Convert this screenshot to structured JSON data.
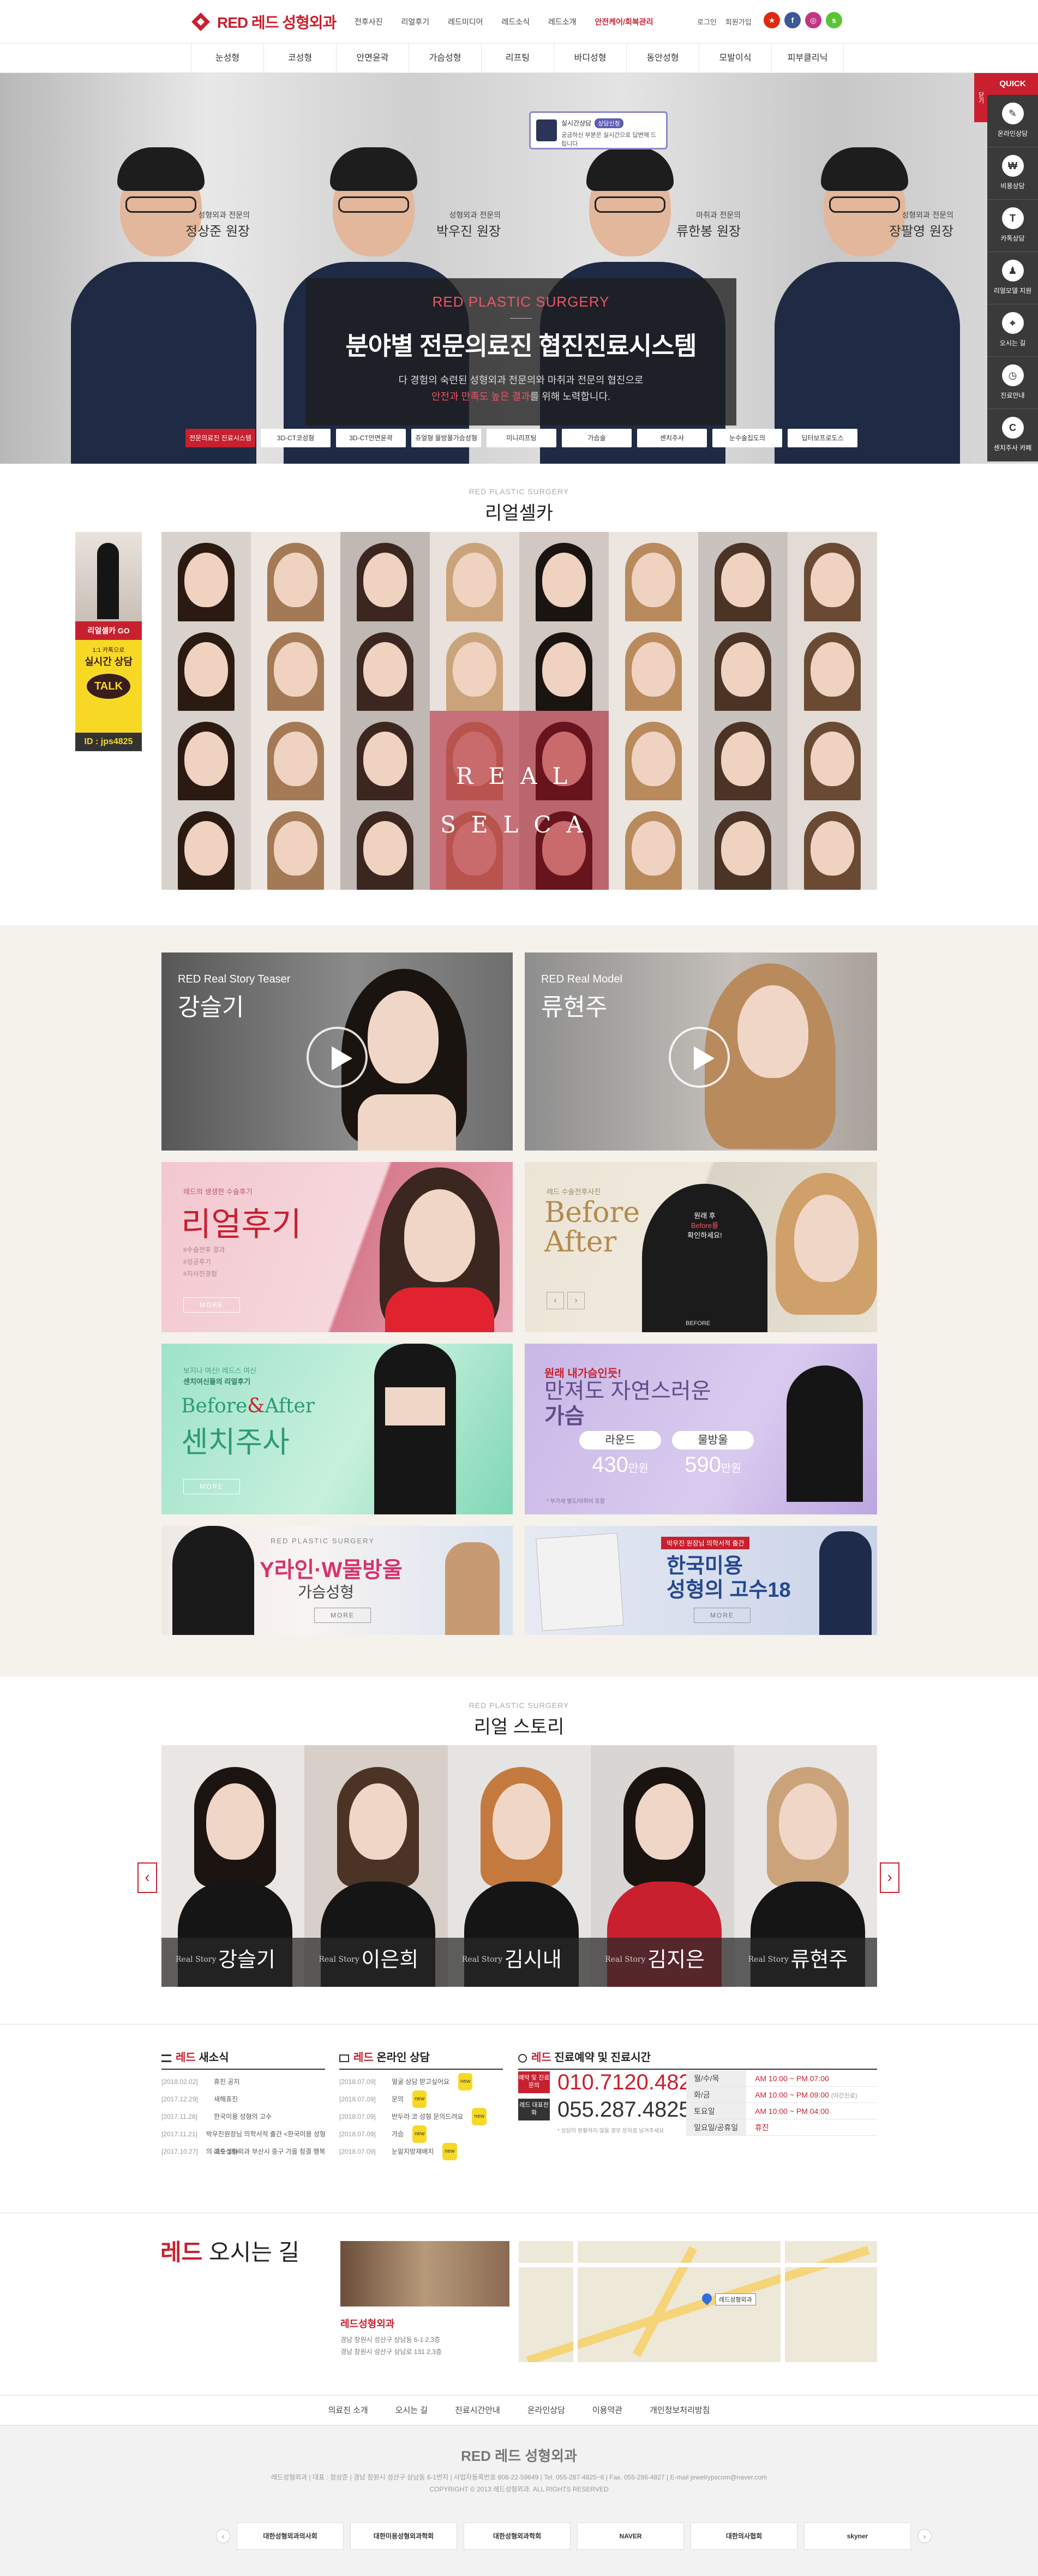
{
  "header": {
    "logo_en": "RED",
    "logo_ko": "레드 성형외과",
    "nav": [
      "전후사진",
      "리얼후기",
      "레드미디어",
      "레드소식",
      "레드소개",
      "안전케어/회복관리"
    ],
    "util": [
      "로그인",
      "회원가입"
    ],
    "social": [
      {
        "name": "china-flag",
        "color": "#de2910",
        "glyph": "★"
      },
      {
        "name": "facebook",
        "color": "#3b5998",
        "glyph": "f"
      },
      {
        "name": "instagram",
        "color": "#c13584",
        "glyph": "◎"
      },
      {
        "name": "kakao-story",
        "color": "#5bc236",
        "glyph": "s"
      }
    ]
  },
  "main_menu": [
    "눈성형",
    "코성형",
    "안면윤곽",
    "가슴성형",
    "리프팅",
    "바디성형",
    "동안성형",
    "모발이식",
    "피부클리닉"
  ],
  "hero": {
    "en_title": "RED PLASTIC SURGERY",
    "title": "분야별 전문의료진 협진진료시스템",
    "desc_1": "다 경험의 숙련된 성형외과 전문의와 마취과 전문의 협진으로",
    "desc_2_red": "안전과 만족도 높은 결과",
    "desc_2_rest": "를 위해 노력합니다.",
    "doctors": [
      {
        "role": "성형외과 전문의",
        "name": "정상준 원장"
      },
      {
        "role": "성형외과 전문의",
        "name": "박우진 원장"
      },
      {
        "role": "마취과 전문의",
        "name": "류한봉 원장"
      },
      {
        "role": "성형외과 전문의",
        "name": "장팔영 원장"
      }
    ],
    "tabs": [
      "전문의료진 진료시스템",
      "3D-CT코성형",
      "3D-CT안면윤곽",
      "쥬얼형 물방울가슴성형",
      "미니리프팅",
      "가슴술",
      "센치주사",
      "눈수술집도의",
      "딥터보프로도스"
    ],
    "chat_title": "실시간상담",
    "chat_tag": "상담신청",
    "chat_text": "궁금하신 부분은 실시간으로 답변해 드립니다"
  },
  "quick": {
    "head": "QUICK",
    "side": "닫기",
    "items": [
      {
        "label": "온라인상담",
        "glyph": "✎"
      },
      {
        "label": "비용상담",
        "glyph": "₩"
      },
      {
        "label": "카톡상담",
        "glyph": "T"
      },
      {
        "label": "리얼모델 지원",
        "glyph": "♟"
      },
      {
        "label": "오시는 길",
        "glyph": "⌖"
      },
      {
        "label": "진료안내",
        "glyph": "◷"
      },
      {
        "label": "센치주사 카페",
        "glyph": "C"
      }
    ]
  },
  "selca": {
    "sub": "RED PLASTIC SURGERY",
    "title": "리얼셀카",
    "overlay_1": "REAL",
    "overlay_2": "SELCA",
    "banner_go": "리얼셀카 GO",
    "kakao_small": "1:1 카톡으로",
    "kakao_big": "실시간 상담",
    "kakao_talk": "TALK",
    "kakao_id": "ID : jps4825"
  },
  "media": {
    "video1_label": "RED Real Story Teaser",
    "video1_name": "강슬기",
    "video2_label": "RED Real Model",
    "video2_name": "류현주",
    "review_small": "레드의 생생한 수술후기",
    "review_title": "리얼후기",
    "review_lines": [
      "#수술전후 결과",
      "#성공후기",
      "#지사진경험"
    ],
    "before_small": "레드 수술전후사진",
    "before_title_1": "Before",
    "before_title_2": "After",
    "before_overlay_1": "원래 후",
    "before_overlay_2": "Before를",
    "before_overlay_3": "확인하세요!",
    "before_label": "BEFORE",
    "senchi_small_1": "보지나 여신! 레드스 여신",
    "senchi_small_2": "센치여신들의 리얼후기",
    "senchi_title_1": "Before",
    "senchi_title_amp": "&",
    "senchi_title_2": "After",
    "senchi_title_3": "센치주사",
    "breast_small": "원래 내가슴인듯!",
    "breast_title_1": "만져도 자연스러운",
    "breast_title_2": "가슴",
    "breast_opt1_label": "라운드",
    "breast_opt1_price": "430",
    "breast_opt2_label": "물방울",
    "breast_opt2_price": "590",
    "price_unit": "만원",
    "breast_note": "* 부가세 별도/마취비 포함",
    "yline_sub": "RED PLASTIC SURGERY",
    "yline_title_1": "Y라인·W물방울",
    "yline_title_2": "가슴성형",
    "book_tag": "박우진 원장님 의학서적 출간",
    "book_title_1": "한국미용",
    "book_title_2": "성형의 고수18",
    "more": "MORE"
  },
  "story": {
    "sub": "RED PLASTIC SURGERY",
    "title": "리얼 스토리",
    "rs": "Real Story",
    "people": [
      "강슬기",
      "이은희",
      "김시내",
      "김지은",
      "류현주"
    ],
    "prev": "‹",
    "next": "›"
  },
  "news": {
    "head_r": "레드",
    "head": " 새소식",
    "items": [
      {
        "date": "[2018.02.02]",
        "title": "휴진 공지"
      },
      {
        "date": "[2017.12.29]",
        "title": "새해휴진"
      },
      {
        "date": "[2017.11.28]",
        "title": "한국미용 성형의 고수"
      },
      {
        "date": "[2017.11.21]",
        "title": "박우진원장님 의학서적 출간 <한국미용 성형의 고수 18>"
      },
      {
        "date": "[2017.10.27]",
        "title": "레드성형외과 부산시 중구 가을 청결 행복"
      }
    ]
  },
  "online": {
    "head_r": "레드",
    "head": " 온라인 상담",
    "new": "new",
    "items": [
      {
        "date": "[2018.07.09]",
        "title": "얼굴 상담 받고싶어요"
      },
      {
        "date": "[2018.07.09]",
        "title": "문의"
      },
      {
        "date": "[2018.07.09]",
        "title": "반두라 코 성형 문의드려요"
      },
      {
        "date": "[2018.07.09]",
        "title": "가슴"
      },
      {
        "date": "[2018.07.09]",
        "title": "눈밑지방재배치"
      }
    ]
  },
  "contact": {
    "head_r": "레드",
    "head": " 진료예약 및 진료시간",
    "tag1": "예약 및 진료문의",
    "phone1": "010.7120.4825",
    "tag2": "레드 대표전화",
    "phone2": "055.287.4825",
    "note": "* 상담이 원활하지 않을 경우 문자로 남겨주세요",
    "hours": [
      {
        "day": "월/수/목",
        "time": "AM 10:00 ~ PM 07:00",
        "extra": ""
      },
      {
        "day": "화/금",
        "time": "AM 10:00 ~ PM 09:00",
        "extra": "(야간진료)"
      },
      {
        "day": "토요일",
        "time": "AM 10:00 ~ PM 04:00",
        "extra": ""
      },
      {
        "day": "일요일/공휴일",
        "time": "휴진",
        "extra": ""
      }
    ]
  },
  "location": {
    "title_r": "레드",
    "title": " 오시는 길",
    "name": "레드성형외과",
    "addr_1": "경남 창원시 성산구 상남동 6-1 2,3층",
    "addr_2": "경남 창원시 성산구 상남로 131 2,3층",
    "map_label": "레드성형외과"
  },
  "footer": {
    "links": [
      "의료진 소개",
      "오시는 길",
      "진료시간안내",
      "온라인상담",
      "이용약관",
      "개인정보처리방침"
    ],
    "logo": "RED 레드 성형외과",
    "info_1": "레드성형외과 | 대표 : 정상준 | 경남 창원시 성산구 상남동 6-1번지 | 사업자등록번호 608-22-59649 | Tel. 055-287-4825~6 | Fax. 055-286-4827 | E-mail jewelrypscom@naver.com",
    "info_2": "COPYRIGHT © 2013 레드성형외과. ALL RIGHTS RESERVED",
    "partners": [
      "대한성형외과의사회",
      "대한미용성형외과학회",
      "대한성형외과학회",
      "NAVER",
      "대한의사협회",
      "skyner"
    ],
    "prev": "‹",
    "next": "›"
  }
}
